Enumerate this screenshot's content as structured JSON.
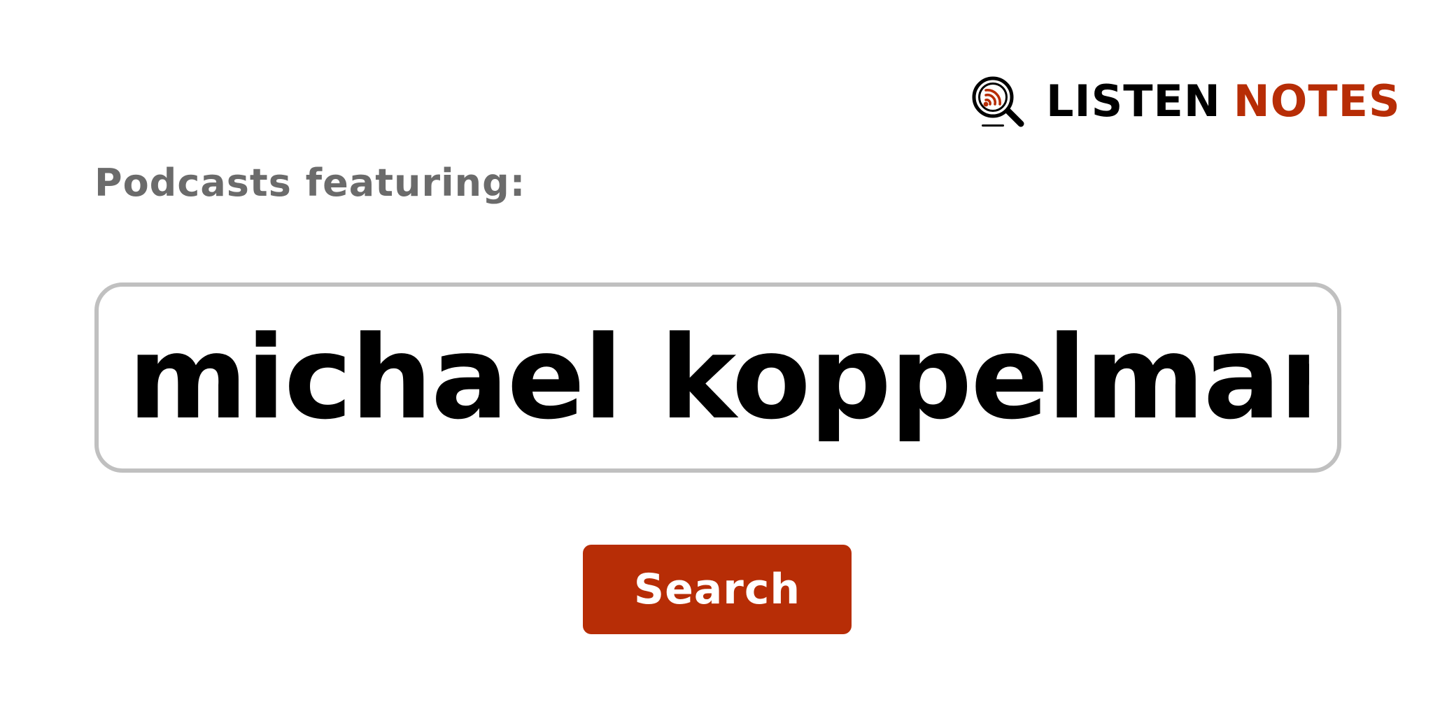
{
  "brand": {
    "word_1": "LISTEN",
    "word_2": "NOTES",
    "accent_color": "#b72d06",
    "logo_icon": "podcast-search-icon"
  },
  "heading": {
    "text": "Podcasts featuring:"
  },
  "search": {
    "value": "michael koppelman"
  },
  "button": {
    "label": "Search",
    "color": "#b72d06"
  }
}
